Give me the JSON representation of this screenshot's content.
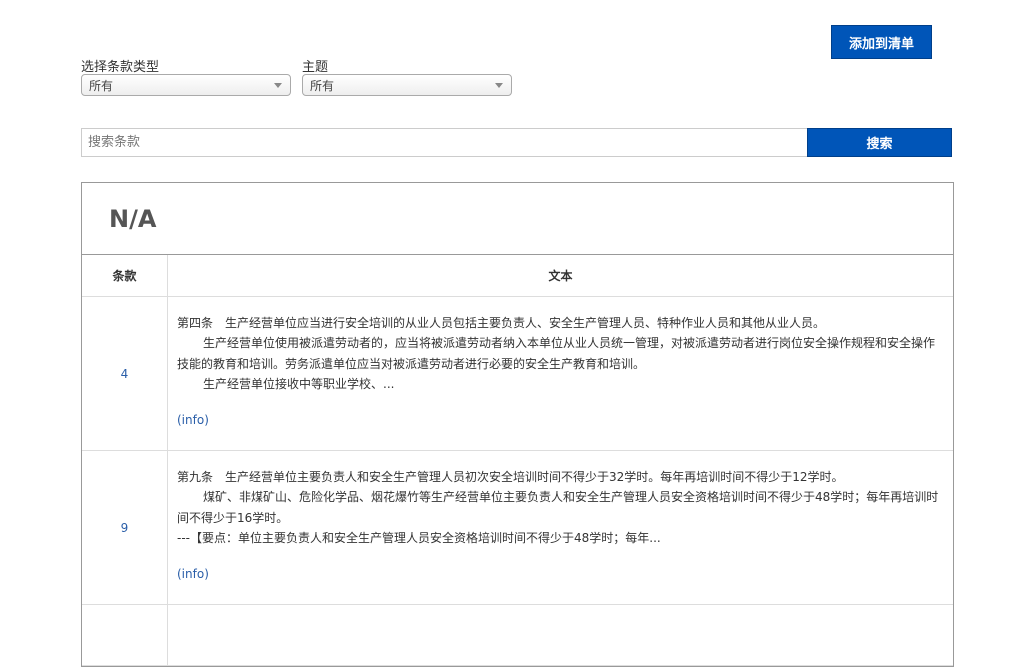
{
  "toolbar": {
    "add_to_list_label": "添加到清单"
  },
  "filters": {
    "clause_type": {
      "label": "选择条款类型",
      "selected": "所有"
    },
    "topic": {
      "label": "主题",
      "selected": "所有"
    }
  },
  "search": {
    "placeholder": "搜索条款",
    "button_label": "搜索"
  },
  "results": {
    "title": "N/A",
    "columns": {
      "number": "条款",
      "text": "文本"
    },
    "rows": [
      {
        "number": "4",
        "paragraphs": [
          "第四条　生产经营单位应当进行安全培训的从业人员包括主要负责人、安全生产管理人员、特种作业人员和其他从业人员。",
          "生产经营单位使用被派遣劳动者的，应当将被派遣劳动者纳入本单位从业人员统一管理，对被派遣劳动者进行岗位安全操作规程和安全操作技能的教育和培训。劳务派遣单位应当对被派遣劳动者进行必要的安全生产教育和培训。",
          "生产经营单位接收中等职业学校、..."
        ],
        "info_label": "(info)"
      },
      {
        "number": "9",
        "paragraphs": [
          "第九条　生产经营单位主要负责人和安全生产管理人员初次安全培训时间不得少于32学时。每年再培训时间不得少于12学时。",
          "煤矿、非煤矿山、危险化学品、烟花爆竹等生产经营单位主要负责人和安全生产管理人员安全资格培训时间不得少于48学时；每年再培训时间不得少于16学时。",
          "---【要点：单位主要负责人和安全生产管理人员安全资格培训时间不得少于48学时；每年..."
        ],
        "info_label": "(info)"
      }
    ]
  },
  "colors": {
    "accent": "#0055b8",
    "link": "#2a5ea8"
  }
}
